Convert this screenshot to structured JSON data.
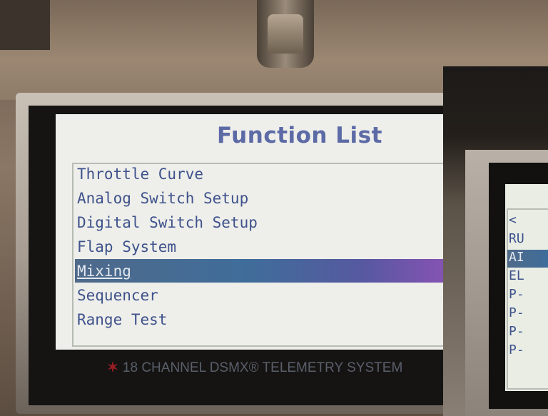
{
  "screen": {
    "title": "Function List",
    "menu_items": [
      "Throttle Curve",
      "Analog Switch Setup",
      "Digital Switch Setup",
      "Flap System",
      "Mixing",
      "Sequencer",
      "Range Test"
    ],
    "selected_item": "Mixing",
    "branding": "18 CHANNEL DSMX® TELEMETRY SYSTEM",
    "colors": {
      "lcd_background": "#eeeeea",
      "title": "#5c6aa6",
      "menu_text": "#3e528c",
      "highlight_start": "#4f6a8a",
      "highlight_end": "#8c52b6"
    }
  },
  "second_screen": {
    "back_glyph": "<",
    "menu_items": [
      "RU",
      "AI",
      "EL",
      "P-",
      "P-",
      "P-",
      "P-"
    ],
    "selected_item": "AI"
  }
}
